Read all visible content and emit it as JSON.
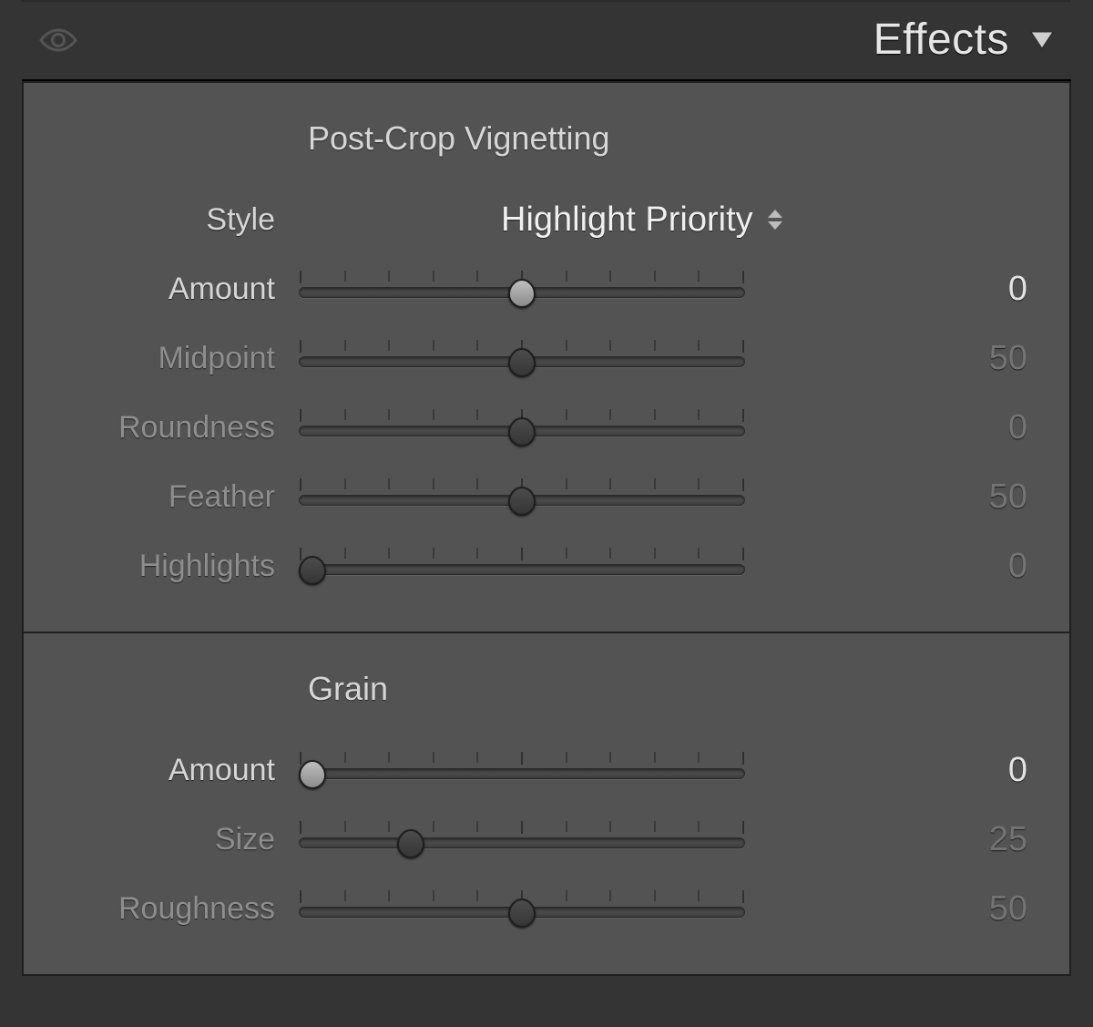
{
  "panel": {
    "title": "Effects"
  },
  "vignette": {
    "section_title": "Post-Crop Vignetting",
    "style_label": "Style",
    "style_value": "Highlight Priority",
    "sliders": [
      {
        "label": "Amount",
        "value": "0",
        "pos": 50,
        "active": true
      },
      {
        "label": "Midpoint",
        "value": "50",
        "pos": 50,
        "active": false
      },
      {
        "label": "Roundness",
        "value": "0",
        "pos": 50,
        "active": false
      },
      {
        "label": "Feather",
        "value": "50",
        "pos": 50,
        "active": false
      },
      {
        "label": "Highlights",
        "value": "0",
        "pos": 3,
        "active": false
      }
    ]
  },
  "grain": {
    "section_title": "Grain",
    "sliders": [
      {
        "label": "Amount",
        "value": "0",
        "pos": 3,
        "active": true
      },
      {
        "label": "Size",
        "value": "25",
        "pos": 25,
        "active": false
      },
      {
        "label": "Roughness",
        "value": "50",
        "pos": 50,
        "active": false
      }
    ]
  }
}
